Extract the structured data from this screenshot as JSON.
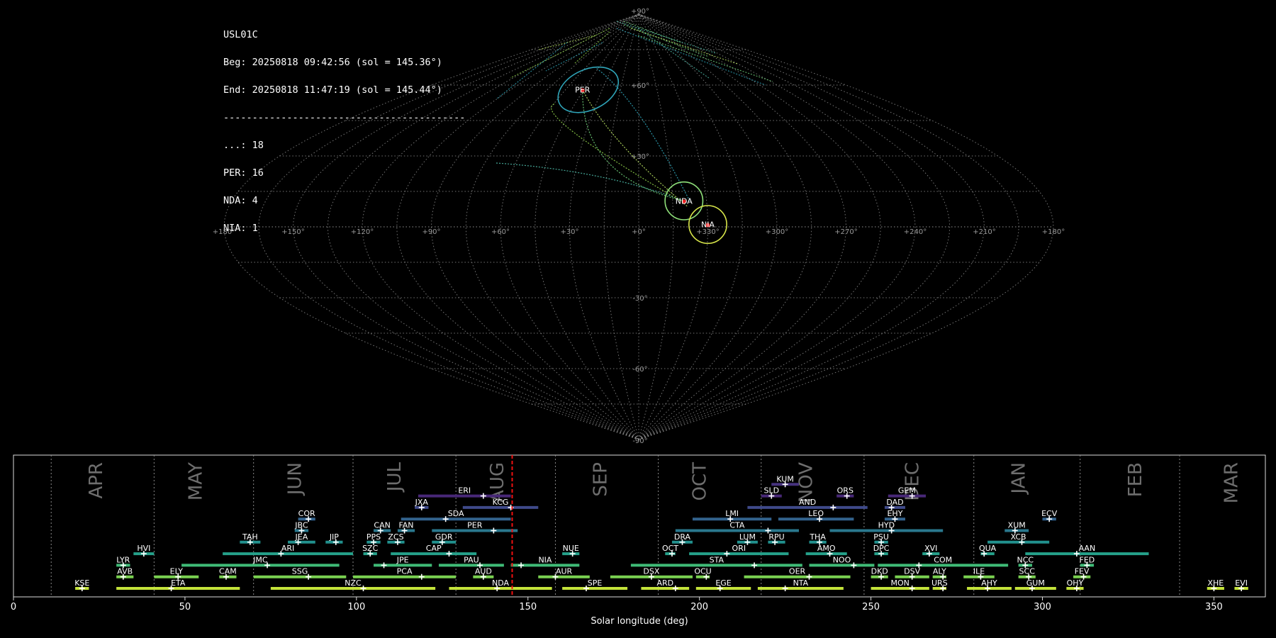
{
  "header": {
    "station": "USL01C",
    "begin": "Beg: 20250818 09:42:56 (sol = 145.36°)",
    "end": "End: 20250818 11:47:19 (sol = 145.44°)",
    "separator": "------------------------------------------",
    "counts": [
      {
        "code": "...",
        "n": 18
      },
      {
        "code": "PER",
        "n": 16
      },
      {
        "code": "NDA",
        "n": 4
      },
      {
        "code": "NIA",
        "n": 1
      }
    ]
  },
  "sky_map": {
    "projection": "sinusoidal",
    "lon_labels": [
      "+180°",
      "+150°",
      "+120°",
      "+90°",
      "+60°",
      "+30°",
      "+0°",
      "+330°",
      "+300°",
      "+270°",
      "+240°",
      "+210°",
      "+180°"
    ],
    "lat_labels": [
      "+90°",
      "+60°",
      "+30°",
      "-30°",
      "-60°",
      "-90°"
    ],
    "radiants": [
      {
        "code": "PER",
        "lon": 46,
        "lat": 58,
        "color": "#2fa4b8",
        "radius_deg": 9
      },
      {
        "code": "NDA",
        "lon": 340,
        "lat": 11,
        "color": "#8fe07a",
        "radius_deg": 8
      },
      {
        "code": "NIA",
        "lon": 330,
        "lat": 1,
        "color": "#d8e64a",
        "radius_deg": 8
      }
    ]
  },
  "chart_data": {
    "type": "timeline",
    "xlabel": "Solar longitude (deg)",
    "xlim": [
      0,
      365
    ],
    "xticks": [
      0,
      50,
      100,
      150,
      200,
      250,
      300,
      350
    ],
    "current_sol": 145.4,
    "months": [
      {
        "name": "APR",
        "start": 11,
        "mid": 24
      },
      {
        "name": "MAY",
        "start": 41,
        "mid": 53
      },
      {
        "name": "JUN",
        "start": 70,
        "mid": 82
      },
      {
        "name": "JUL",
        "start": 99,
        "mid": 111
      },
      {
        "name": "AUG",
        "start": 129,
        "mid": 141
      },
      {
        "name": "SEP",
        "start": 158,
        "mid": 171
      },
      {
        "name": "OCT",
        "start": 188,
        "mid": 200
      },
      {
        "name": "NOV",
        "start": 218,
        "mid": 231
      },
      {
        "name": "DEC",
        "start": 248,
        "mid": 262
      },
      {
        "name": "JAN",
        "start": 280,
        "mid": 293
      },
      {
        "name": "FEB",
        "start": 311,
        "mid": 327
      },
      {
        "name": "MAR",
        "start": 340,
        "mid": 355
      }
    ],
    "showers": [
      {
        "code": "KUM",
        "start": 221,
        "end": 229,
        "peak": 225,
        "row": 10
      },
      {
        "code": "ERI",
        "start": 118,
        "end": 145,
        "peak": 137,
        "row": 9
      },
      {
        "code": "SLD",
        "start": 218,
        "end": 224,
        "peak": 221,
        "row": 9
      },
      {
        "code": "ORS",
        "start": 240,
        "end": 245,
        "peak": 243,
        "row": 9
      },
      {
        "code": "GEM",
        "start": 255,
        "end": 266,
        "peak": 262,
        "row": 9
      },
      {
        "code": "JXA",
        "start": 117,
        "end": 121,
        "peak": 119,
        "row": 8
      },
      {
        "code": "KCG",
        "start": 131,
        "end": 153,
        "peak": 145,
        "row": 8
      },
      {
        "code": "AND",
        "start": 214,
        "end": 249,
        "peak": 239,
        "row": 8
      },
      {
        "code": "DAD",
        "start": 254,
        "end": 260,
        "peak": 256,
        "row": 8
      },
      {
        "code": "COR",
        "start": 83,
        "end": 88,
        "peak": 86,
        "row": 7
      },
      {
        "code": "SDA",
        "start": 113,
        "end": 145,
        "peak": 126,
        "row": 7
      },
      {
        "code": "LMI",
        "start": 198,
        "end": 221,
        "peak": 209,
        "row": 7
      },
      {
        "code": "LEO",
        "start": 223,
        "end": 245,
        "peak": 235,
        "row": 7
      },
      {
        "code": "EHY",
        "start": 254,
        "end": 260,
        "peak": 257,
        "row": 7
      },
      {
        "code": "ECV",
        "start": 300,
        "end": 304,
        "peak": 302,
        "row": 7
      },
      {
        "code": "JBC",
        "start": 82,
        "end": 86,
        "peak": 84,
        "row": 6
      },
      {
        "code": "CAN",
        "start": 105,
        "end": 110,
        "peak": 107,
        "row": 6
      },
      {
        "code": "FAN",
        "start": 112,
        "end": 117,
        "peak": 114,
        "row": 6
      },
      {
        "code": "PER",
        "start": 122,
        "end": 147,
        "peak": 140,
        "row": 6
      },
      {
        "code": "CTA",
        "start": 193,
        "end": 229,
        "peak": 220,
        "row": 6
      },
      {
        "code": "HYD",
        "start": 238,
        "end": 271,
        "peak": 256,
        "row": 6
      },
      {
        "code": "XUM",
        "start": 289,
        "end": 296,
        "peak": 292,
        "row": 6
      },
      {
        "code": "TAH",
        "start": 66,
        "end": 72,
        "peak": 69,
        "row": 5
      },
      {
        "code": "JEA",
        "start": 80,
        "end": 88,
        "peak": 83,
        "row": 5
      },
      {
        "code": "JIP",
        "start": 91,
        "end": 96,
        "peak": 94,
        "row": 5
      },
      {
        "code": "PPS",
        "start": 103,
        "end": 107,
        "peak": 105,
        "row": 5
      },
      {
        "code": "ZCS",
        "start": 109,
        "end": 114,
        "peak": 112,
        "row": 5
      },
      {
        "code": "GDR",
        "start": 122,
        "end": 129,
        "peak": 125,
        "row": 5
      },
      {
        "code": "DRA",
        "start": 192,
        "end": 198,
        "peak": 195,
        "row": 5
      },
      {
        "code": "LUM",
        "start": 211,
        "end": 217,
        "peak": 214,
        "row": 5
      },
      {
        "code": "RPU",
        "start": 220,
        "end": 225,
        "peak": 222,
        "row": 5
      },
      {
        "code": "THA",
        "start": 232,
        "end": 237,
        "peak": 235,
        "row": 5
      },
      {
        "code": "PSU",
        "start": 251,
        "end": 255,
        "peak": 253,
        "row": 5
      },
      {
        "code": "XCB",
        "start": 284,
        "end": 302,
        "peak": 294,
        "row": 5
      },
      {
        "code": "HVI",
        "start": 35,
        "end": 41,
        "peak": 38,
        "row": 4
      },
      {
        "code": "ARI",
        "start": 61,
        "end": 99,
        "peak": 78,
        "row": 4
      },
      {
        "code": "SZC",
        "start": 102,
        "end": 106,
        "peak": 104,
        "row": 4
      },
      {
        "code": "CAP",
        "start": 110,
        "end": 135,
        "peak": 127,
        "row": 4
      },
      {
        "code": "NUE",
        "start": 160,
        "end": 165,
        "peak": 163,
        "row": 4
      },
      {
        "code": "OCT",
        "start": 190,
        "end": 193,
        "peak": 192,
        "row": 4
      },
      {
        "code": "ORI",
        "start": 197,
        "end": 226,
        "peak": 208,
        "row": 4
      },
      {
        "code": "AMO",
        "start": 231,
        "end": 243,
        "peak": 238,
        "row": 4
      },
      {
        "code": "DPC",
        "start": 251,
        "end": 255,
        "peak": 253,
        "row": 4
      },
      {
        "code": "XVI",
        "start": 265,
        "end": 270,
        "peak": 267,
        "row": 4
      },
      {
        "code": "QUA",
        "start": 282,
        "end": 286,
        "peak": 283,
        "row": 4
      },
      {
        "code": "AAN",
        "start": 295,
        "end": 331,
        "peak": 310,
        "row": 4
      },
      {
        "code": "LYR",
        "start": 30,
        "end": 34,
        "peak": 32,
        "row": 3
      },
      {
        "code": "JMC",
        "start": 49,
        "end": 95,
        "peak": 74,
        "row": 3
      },
      {
        "code": "JPE",
        "start": 105,
        "end": 122,
        "peak": 108,
        "row": 3
      },
      {
        "code": "PAU",
        "start": 124,
        "end": 143,
        "peak": 136,
        "row": 3
      },
      {
        "code": "NIA",
        "start": 145,
        "end": 165,
        "peak": 148,
        "row": 3
      },
      {
        "code": "STA",
        "start": 180,
        "end": 230,
        "peak": 216,
        "row": 3
      },
      {
        "code": "NOO",
        "start": 232,
        "end": 251,
        "peak": 245,
        "row": 3
      },
      {
        "code": "COM",
        "start": 252,
        "end": 290,
        "peak": 264,
        "row": 3
      },
      {
        "code": "NCC",
        "start": 293,
        "end": 297,
        "peak": 295,
        "row": 3
      },
      {
        "code": "FED",
        "start": 311,
        "end": 315,
        "peak": 313,
        "row": 3
      },
      {
        "code": "AVB",
        "start": 30,
        "end": 35,
        "peak": 32,
        "row": 2
      },
      {
        "code": "ELY",
        "start": 41,
        "end": 54,
        "peak": 48,
        "row": 2
      },
      {
        "code": "CAM",
        "start": 60,
        "end": 65,
        "peak": 62,
        "row": 2
      },
      {
        "code": "SSG",
        "start": 70,
        "end": 97,
        "peak": 86,
        "row": 2
      },
      {
        "code": "PCA",
        "start": 99,
        "end": 129,
        "peak": 119,
        "row": 2
      },
      {
        "code": "AUD",
        "start": 134,
        "end": 140,
        "peak": 137,
        "row": 2
      },
      {
        "code": "AUR",
        "start": 153,
        "end": 168,
        "peak": 158,
        "row": 2
      },
      {
        "code": "DSX",
        "start": 174,
        "end": 198,
        "peak": 186,
        "row": 2
      },
      {
        "code": "OCU",
        "start": 199,
        "end": 203,
        "peak": 202,
        "row": 2
      },
      {
        "code": "OER",
        "start": 213,
        "end": 244,
        "peak": 232,
        "row": 2
      },
      {
        "code": "DKD",
        "start": 250,
        "end": 255,
        "peak": 253,
        "row": 2
      },
      {
        "code": "DSV",
        "start": 257,
        "end": 267,
        "peak": 262,
        "row": 2
      },
      {
        "code": "ALY",
        "start": 268,
        "end": 272,
        "peak": 271,
        "row": 2
      },
      {
        "code": "ILE",
        "start": 277,
        "end": 286,
        "peak": 282,
        "row": 2
      },
      {
        "code": "SCC",
        "start": 293,
        "end": 298,
        "peak": 296,
        "row": 2
      },
      {
        "code": "FEV",
        "start": 309,
        "end": 314,
        "peak": 312,
        "row": 2
      },
      {
        "code": "KSE",
        "start": 18,
        "end": 22,
        "peak": 20,
        "row": 1
      },
      {
        "code": "ETA",
        "start": 30,
        "end": 66,
        "peak": 46,
        "row": 1
      },
      {
        "code": "NZC",
        "start": 75,
        "end": 123,
        "peak": 102,
        "row": 1
      },
      {
        "code": "NDA",
        "start": 127,
        "end": 157,
        "peak": 141,
        "row": 1
      },
      {
        "code": "SPE",
        "start": 160,
        "end": 179,
        "peak": 167,
        "row": 1
      },
      {
        "code": "ARD",
        "start": 183,
        "end": 197,
        "peak": 193,
        "row": 1
      },
      {
        "code": "EGE",
        "start": 199,
        "end": 215,
        "peak": 206,
        "row": 1
      },
      {
        "code": "NTA",
        "start": 217,
        "end": 242,
        "peak": 225,
        "row": 1
      },
      {
        "code": "MON",
        "start": 250,
        "end": 267,
        "peak": 262,
        "row": 1
      },
      {
        "code": "URS",
        "start": 268,
        "end": 272,
        "peak": 271,
        "row": 1
      },
      {
        "code": "AHY",
        "start": 278,
        "end": 291,
        "peak": 284,
        "row": 1
      },
      {
        "code": "GUM",
        "start": 292,
        "end": 304,
        "peak": 297,
        "row": 1
      },
      {
        "code": "OHY",
        "start": 307,
        "end": 312,
        "peak": 310,
        "row": 1
      },
      {
        "code": "XHE",
        "start": 348,
        "end": 353,
        "peak": 350,
        "row": 1
      },
      {
        "code": "EVI",
        "start": 356,
        "end": 360,
        "peak": 358,
        "row": 1
      }
    ]
  }
}
